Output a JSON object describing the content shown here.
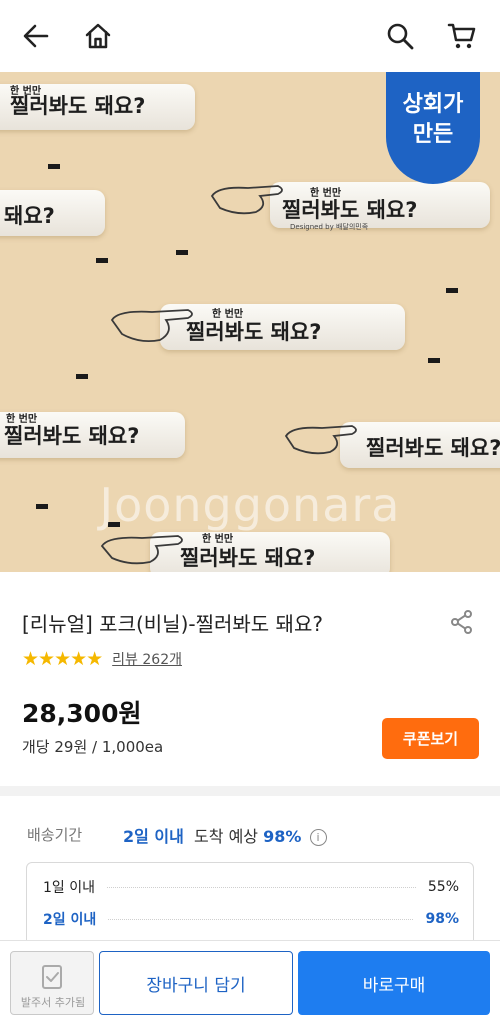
{
  "header": {
    "back_icon": "arrow-left-icon",
    "home_icon": "home-icon",
    "search_icon": "search-icon",
    "cart_icon": "cart-icon"
  },
  "hero": {
    "badge_line1": "상회가",
    "badge_line2": "만든",
    "fork_print_small": "한 번만",
    "fork_print_main": "찔러봐도 돼요?",
    "fork_print_tail": "돼요?",
    "fork_print_sub": "Designed by 배달의민족",
    "watermark": "Joonggonara"
  },
  "product": {
    "title": "[리뉴얼] 포크(비닐)-찔러봐도 돼요?",
    "stars": "★★★★★",
    "review_link": "리뷰 262개",
    "price": "28,300원",
    "unit_price": "개당 29원 / 1,000ea",
    "coupon_button": "쿠폰보기"
  },
  "delivery": {
    "label": "배송기간",
    "days": "2일 이내",
    "arrival_text": "도착 예상",
    "percent": "98%",
    "rows": [
      {
        "label": "1일 이내",
        "value": "55%"
      },
      {
        "label": "2일 이내",
        "value": "98%"
      }
    ]
  },
  "bottom_bar": {
    "order_sheet_label": "발주서 추가됨",
    "cart_button": "장바구니 담기",
    "buy_button": "바로구매"
  },
  "colors": {
    "brand_blue": "#1e63c4",
    "buy_blue": "#1e7df0",
    "coupon_orange": "#ff6c0e",
    "star_yellow": "#f5b800",
    "hero_bg": "#ecd6b1"
  }
}
